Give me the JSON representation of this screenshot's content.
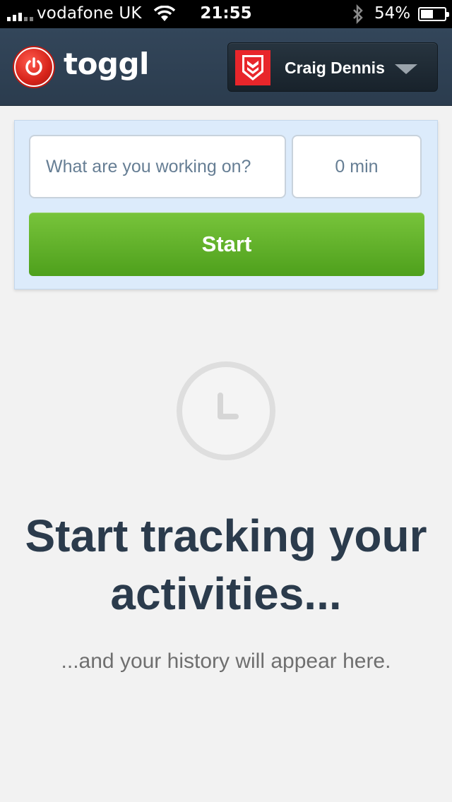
{
  "status_bar": {
    "carrier": "vodafone UK",
    "time": "21:55",
    "battery_percent": "54%",
    "battery_level": 0.54,
    "icons": [
      "signal-icon",
      "wifi-icon",
      "bluetooth-icon",
      "battery-icon"
    ]
  },
  "header": {
    "logo_text": "toggl",
    "user_name": "Craig Dennis"
  },
  "timer": {
    "description_placeholder": "What are you working on?",
    "duration_placeholder": "0 min",
    "start_label": "Start"
  },
  "empty_state": {
    "title": "Start tracking your activities...",
    "subtitle": "...and your history will appear here."
  },
  "colors": {
    "header": "#2f4254",
    "start_button": "#5cae2a",
    "timer_panel": "#dcebfb",
    "title_text": "#2b3b4c",
    "avatar": "#e8262b"
  }
}
